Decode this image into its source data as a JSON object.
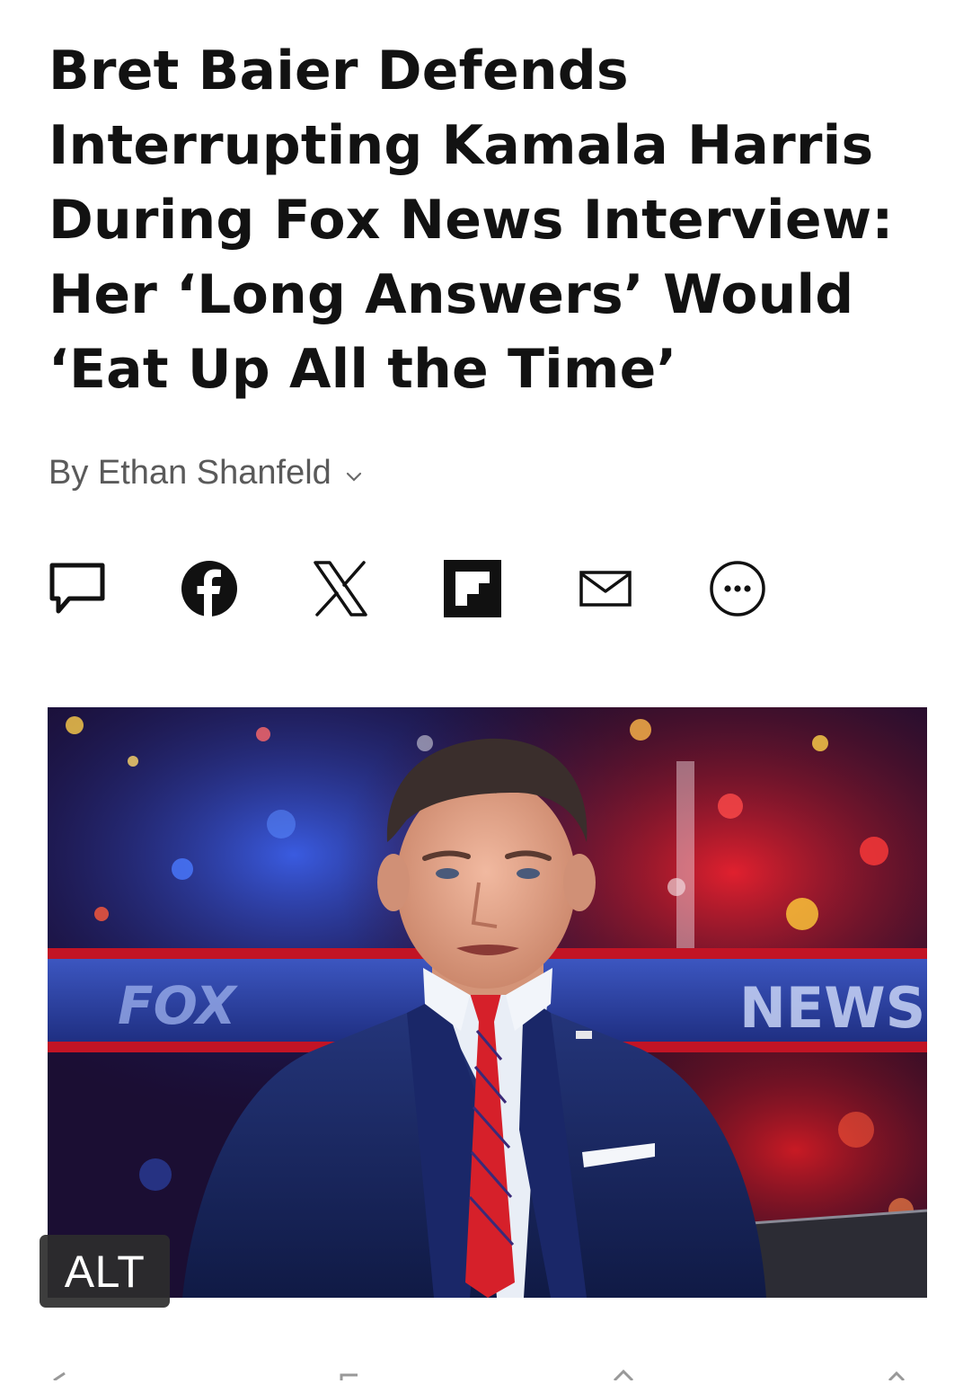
{
  "article": {
    "headline_lines": [
      "Bret Baier Defends",
      "Interrupting Kamala Harris",
      "During Fox News Interview:",
      "Her ‘Long Answers’ Would",
      "‘Eat Up All the Time’"
    ],
    "byline": "By Ethan Shanfeld"
  },
  "share_bar": {
    "icons": [
      "comment-icon",
      "facebook-icon",
      "x-icon",
      "flipboard-icon",
      "email-icon",
      "more-icon"
    ]
  },
  "hero_image": {
    "alt_badge": "ALT",
    "backdrop_text_left": "FOX",
    "backdrop_text_right": "NEWS"
  },
  "colors": {
    "headline": "#121212",
    "byline": "#5a5a5a",
    "suit_navy": "#1c2a5e",
    "tie_red": "#d6202a",
    "backdrop_blue": "#2a3f9e",
    "backdrop_red": "#c0152a"
  }
}
